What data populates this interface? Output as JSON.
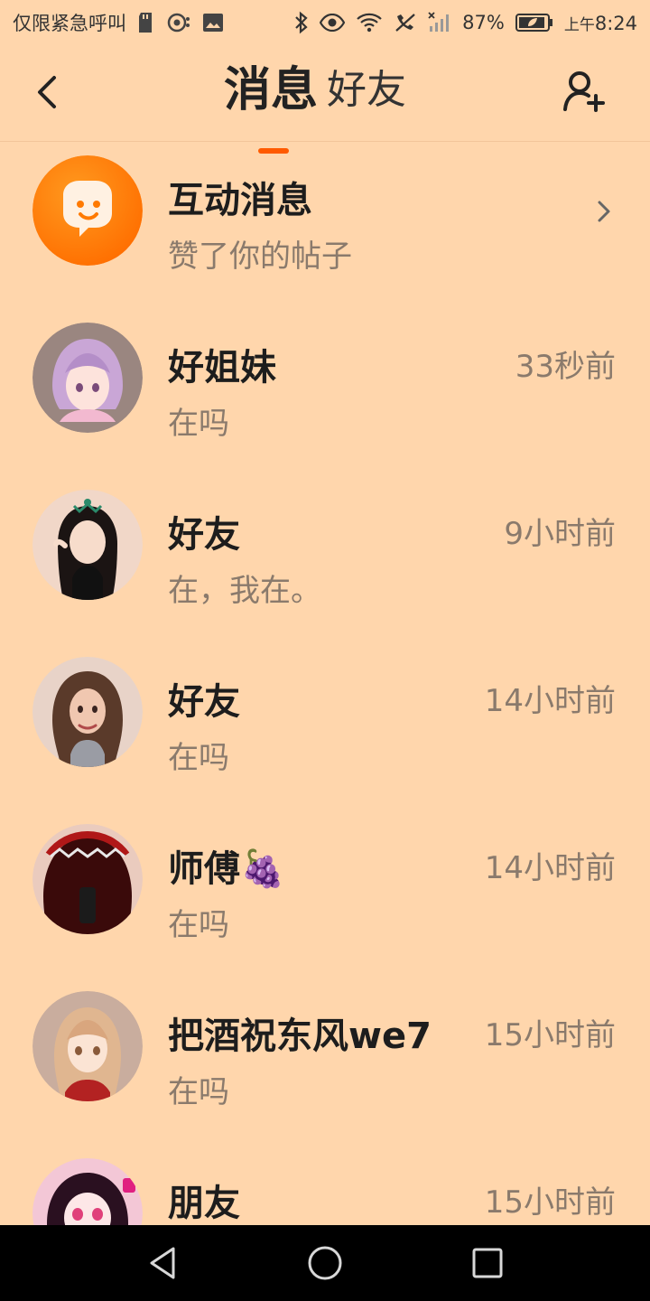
{
  "status_bar": {
    "carrier": "仅限紧急呼叫",
    "battery": "87%",
    "ampm": "上午",
    "time": "8:24"
  },
  "header": {
    "active_tab": "消息",
    "inactive_tab": "好友"
  },
  "colors": {
    "background": "#FFD6AC",
    "accent": "#FF5A00",
    "interaction_badge": "#FF7A00"
  },
  "messages": [
    {
      "name": "互动消息",
      "preview": "赞了你的帖子",
      "time": "",
      "avatar_icon": "interaction-chat-icon"
    },
    {
      "name": "好姐妹",
      "preview": "在吗",
      "time": "33秒前",
      "avatar_icon": "avatar-lavender-hair"
    },
    {
      "name": "好友",
      "preview": "在，我在。",
      "time": "9小时前",
      "avatar_icon": "avatar-black-hair-tiara"
    },
    {
      "name": "好友",
      "preview": "在吗",
      "time": "14小时前",
      "avatar_icon": "avatar-curly-brown-hair"
    },
    {
      "name": "师傅",
      "name_emoji": "🍇",
      "preview": "在吗",
      "time": "14小时前",
      "avatar_icon": "avatar-red-hair-crown"
    },
    {
      "name": "把酒祝东风we7",
      "preview": "在吗",
      "time": "15小时前",
      "avatar_icon": "avatar-blonde-girl"
    },
    {
      "name": "朋友",
      "preview": "",
      "time": "15小时前",
      "avatar_icon": "avatar-pink-smiling-girl"
    }
  ]
}
